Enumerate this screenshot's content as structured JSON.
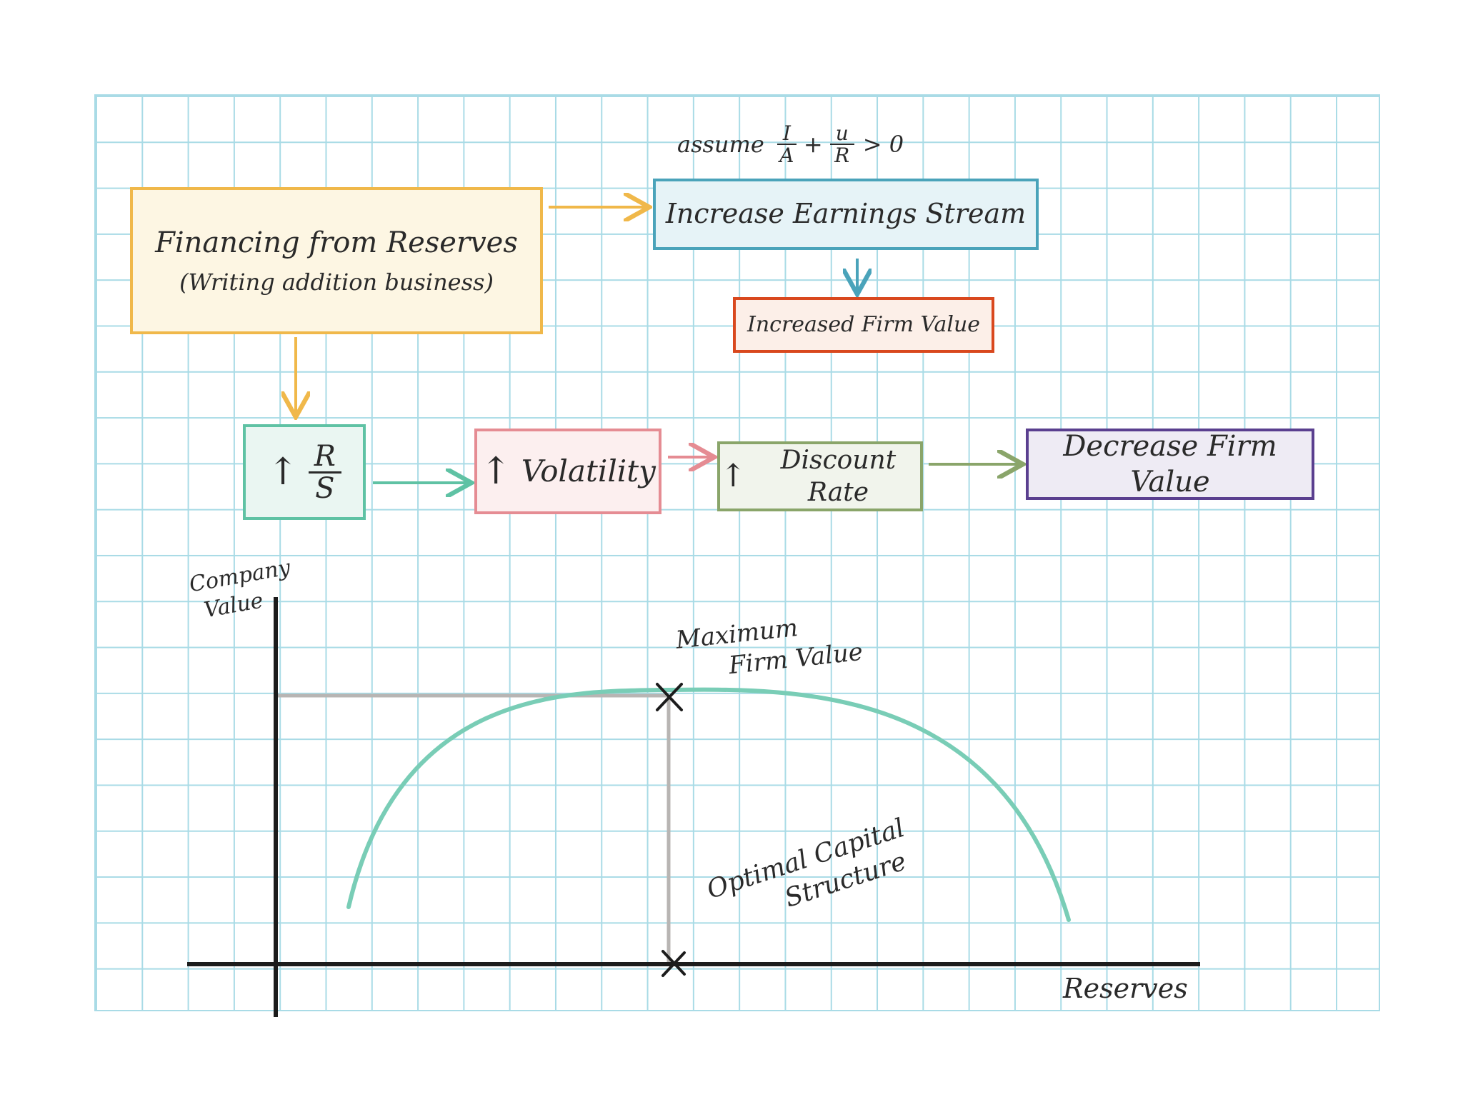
{
  "assumption": {
    "prefix": "assume",
    "frac1_num": "I",
    "frac1_den": "A",
    "plus": "+",
    "frac2_num": "u",
    "frac2_den": "R",
    "comparison": "> 0"
  },
  "boxes": {
    "financing": {
      "line1": "Financing from Reserves",
      "line2": "(Writing addition business)",
      "color": "#f0b84a",
      "fill": "#fdf6e3"
    },
    "earnings": {
      "label": "Increase Earnings Stream",
      "color": "#4aa3ba",
      "fill": "#e6f3f7"
    },
    "firmvalue": {
      "label": "Increased Firm Value",
      "color": "#d9481e",
      "fill": "#fcefe8"
    },
    "ratio": {
      "arrow": "↑",
      "num": "R",
      "den": "S",
      "color": "#5fc2a4",
      "fill": "#eaf6f2"
    },
    "volatility": {
      "arrow": "↑",
      "label": "Volatility",
      "color": "#e58c93",
      "fill": "#fcefef"
    },
    "discount": {
      "arrow": "↑",
      "label": "Discount Rate",
      "color": "#8aa56a",
      "fill": "#f1f4ec"
    },
    "decrease": {
      "label": "Decrease Firm Value",
      "color": "#5a3f8f",
      "fill": "#eeebf4"
    }
  },
  "graph": {
    "ylabel_line1": "Company",
    "ylabel_line2": "Value",
    "xlabel": "Reserves",
    "max_label_line1": "Maximum",
    "max_label_line2": "Firm Value",
    "optimal_label_line1": "Optimal Capital",
    "optimal_label_line2": "Structure",
    "curve_color": "#79cdb6",
    "guide_color": "#b8b5b3",
    "axis_color": "#1c1c1c"
  }
}
